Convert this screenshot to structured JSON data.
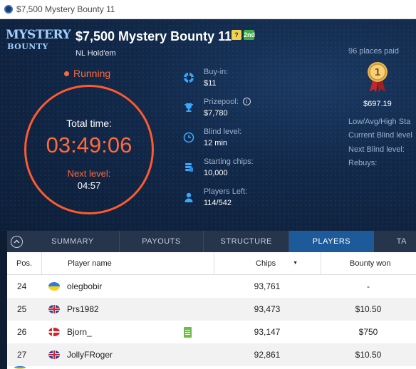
{
  "window": {
    "title": "$7,500 Mystery Bounty 11"
  },
  "logo": {
    "line1": "MYSTERY",
    "line2": "BOUNTY"
  },
  "tournament": {
    "title": "$7,500 Mystery Bounty 11",
    "badge_q": "?",
    "badge_nd": "2nd",
    "game": "NL Hold'em",
    "status": "Running"
  },
  "clock": {
    "total_label": "Total time:",
    "total_value": "03:49:06",
    "next_label": "Next level:",
    "next_value": "04:57"
  },
  "stats": [
    {
      "label": "Buy-in:",
      "value": "$11",
      "icon": "chip-icon"
    },
    {
      "label": "Prizepool:",
      "value": "$7,780",
      "icon": "trophy-icon"
    },
    {
      "label": "Blind level:",
      "value": "12 min",
      "icon": "clock-icon"
    },
    {
      "label": "Starting chips:",
      "value": "10,000",
      "icon": "chip-stack-icon"
    },
    {
      "label": "Players Left:",
      "value": "114/542",
      "icon": "person-icon"
    }
  ],
  "prizes": {
    "places_paid": "96 places paid",
    "first_prize": "$697.19",
    "medal_number": "1"
  },
  "right_info": {
    "stacks": "Low/Avg/High Sta",
    "current_blind": "Current Blind level",
    "next_blind": "Next Blind level:",
    "rebuys": "Rebuys:"
  },
  "tabs": [
    "SUMMARY",
    "PAYOUTS",
    "STRUCTURE",
    "PLAYERS",
    "TA"
  ],
  "active_tab": "PLAYERS",
  "table": {
    "headers": {
      "pos": "Pos.",
      "name": "Player name",
      "chips": "Chips",
      "bounty": "Bounty won"
    },
    "rows": [
      {
        "pos": "24",
        "flag": "ua",
        "name": "olegbobir",
        "chips": "93,761",
        "bounty": "-",
        "note": false
      },
      {
        "pos": "25",
        "flag": "gb",
        "name": "Prs1982",
        "chips": "93,473",
        "bounty": "$10.50",
        "note": false
      },
      {
        "pos": "26",
        "flag": "dk",
        "name": "Bjorn_",
        "chips": "93,147",
        "bounty": "$750",
        "note": true
      },
      {
        "pos": "27",
        "flag": "gb",
        "name": "JollyFRoger",
        "chips": "92,861",
        "bounty": "$10.50",
        "note": false
      }
    ]
  },
  "colors": {
    "accent_orange": "#ff6a3d",
    "active_tab": "#1d5a9a",
    "icon_blue": "#38a8ff"
  }
}
